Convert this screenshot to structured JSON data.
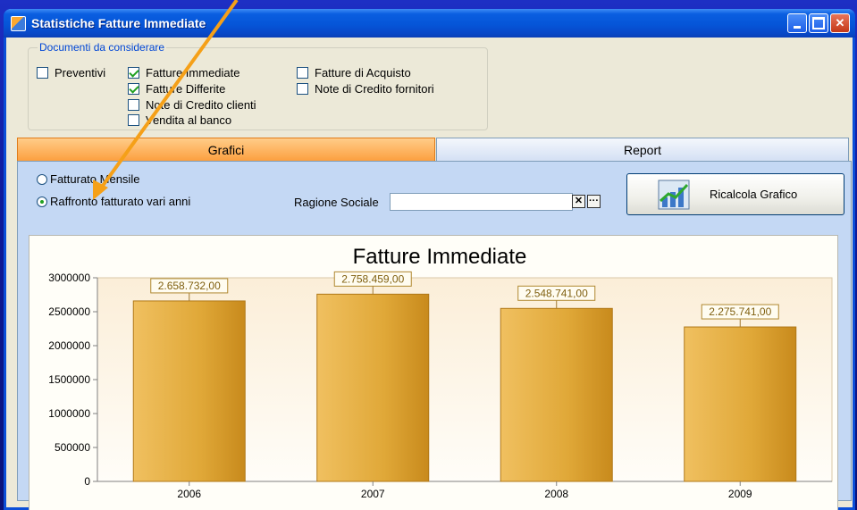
{
  "window": {
    "title": "Statistiche Fatture Immediate"
  },
  "documents_group": {
    "legend": "Documenti da considerare",
    "checkboxes": [
      {
        "label": "Preventivi",
        "checked": false
      },
      {
        "label": "Fatture Immediate",
        "checked": true
      },
      {
        "label": "Fatture Differite",
        "checked": true
      },
      {
        "label": "Note di Credito clienti",
        "checked": false
      },
      {
        "label": "Vendita al banco",
        "checked": false
      },
      {
        "label": "Fatture di Acquisto",
        "checked": false
      },
      {
        "label": "Note di Credito fornitori",
        "checked": false
      }
    ]
  },
  "tabs": [
    {
      "label": "Grafici",
      "active": true
    },
    {
      "label": "Report",
      "active": false
    }
  ],
  "options": {
    "radios": [
      {
        "label": "Fatturato Mensile",
        "selected": false
      },
      {
        "label": "Raffronto fatturato vari anni",
        "selected": true
      }
    ],
    "ragione_sociale_label": "Ragione Sociale",
    "ragione_sociale_value": "",
    "clear_button": "✕",
    "browse_button": "···",
    "recalc_button": "Ricalcola Grafico"
  },
  "chart_data": {
    "type": "bar",
    "title": "Fatture Immediate",
    "categories": [
      "2006",
      "2007",
      "2008",
      "2009"
    ],
    "values": [
      2658732,
      2758459,
      2548741,
      2275741
    ],
    "data_labels": [
      "2.658.732,00",
      "2.758.459,00",
      "2.548.741,00",
      "2.275.741,00"
    ],
    "ylim": [
      0,
      3000000
    ],
    "yticks": [
      0,
      500000,
      1000000,
      1500000,
      2000000,
      2500000,
      3000000
    ],
    "ytick_labels": [
      "0",
      "500000",
      "1000000",
      "1500000",
      "2000000",
      "2500000",
      "3000000"
    ],
    "bar_color": "#e0a838",
    "grid": false,
    "legend": "none"
  },
  "colors": {
    "accent_tab": "#fca040",
    "annotation_arrow": "#f5a018"
  }
}
